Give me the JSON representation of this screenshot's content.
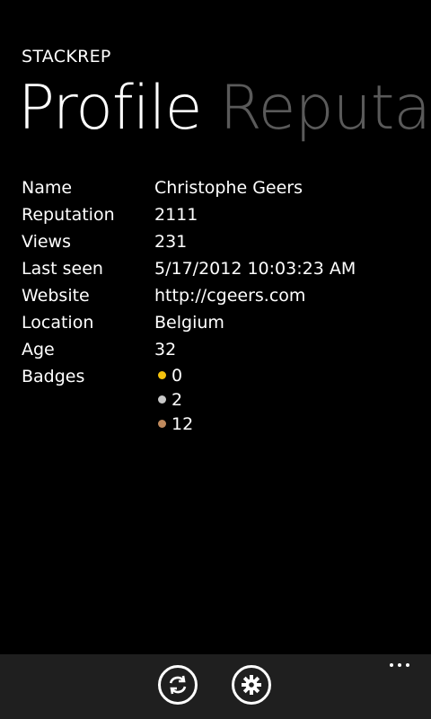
{
  "app": {
    "title": "STACKREP"
  },
  "pivot": {
    "items": [
      {
        "label": "Profile",
        "active": true
      },
      {
        "label": "Reputat",
        "active": false
      }
    ]
  },
  "profile": {
    "rows": [
      {
        "label": "Name",
        "value": "Christophe Geers"
      },
      {
        "label": "Reputation",
        "value": "2111"
      },
      {
        "label": "Views",
        "value": "231"
      },
      {
        "label": "Last seen",
        "value": "5/17/2012 10:03:23 AM"
      },
      {
        "label": "Website",
        "value": "http://cgeers.com"
      },
      {
        "label": "Location",
        "value": "Belgium"
      },
      {
        "label": "Age",
        "value": "32"
      },
      {
        "label": "Badges",
        "value": ""
      }
    ],
    "badges": [
      {
        "type": "gold",
        "count": "0",
        "color": "#f4c20d"
      },
      {
        "type": "silver",
        "count": "2",
        "color": "#c8c8c8"
      },
      {
        "type": "bronze",
        "count": "12",
        "color": "#c08a5d"
      }
    ]
  },
  "appbar": {
    "buttons": [
      {
        "name": "refresh-button",
        "icon": "refresh-icon"
      },
      {
        "name": "settings-button",
        "icon": "gear-icon"
      }
    ],
    "more_icon": "more-icon"
  }
}
